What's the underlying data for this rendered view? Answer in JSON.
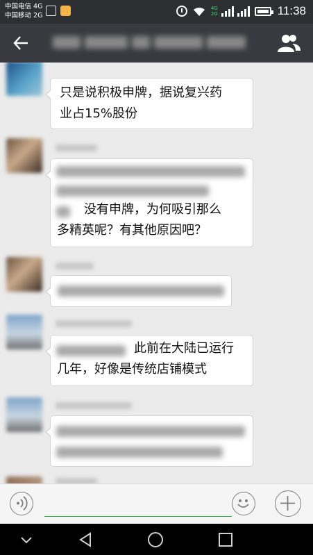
{
  "status_bar": {
    "carrier_1": "中国电信 4G",
    "carrier_2": "中国移动 2G",
    "net_badge_1": "4G",
    "net_badge_2": "2G",
    "time": "11:38",
    "icons": [
      "image-icon",
      "app-notification-icon",
      "alarm-icon",
      "wifi-icon",
      "signal-icon",
      "battery-icon"
    ]
  },
  "header": {
    "title": "",
    "icons": [
      "back-arrow-icon",
      "group-members-icon"
    ]
  },
  "messages": [
    {
      "id": 1,
      "sender_visible": false,
      "lines": [
        "只是说积极申牌，据说复兴药",
        "业占15%股份"
      ]
    },
    {
      "id": 2,
      "sender_visible": false,
      "lines": [
        "没有申牌，为何吸引那么",
        "多精英呢？有其他原因吧？"
      ]
    },
    {
      "id": 3,
      "sender_visible": false,
      "lines": []
    },
    {
      "id": 4,
      "sender_visible": false,
      "lines": [
        "此前在大陆已运行",
        "几年，好像是传统店铺模式"
      ]
    },
    {
      "id": 5,
      "sender_visible": false,
      "lines": []
    }
  ],
  "input_bar": {
    "icons": [
      "voice-icon",
      "emoji-icon",
      "plus-icon"
    ],
    "accent_color": "#2ea94a"
  },
  "nav_bar": {
    "icons": [
      "hide-keyboard-icon",
      "back-icon",
      "home-icon",
      "recents-icon"
    ]
  }
}
